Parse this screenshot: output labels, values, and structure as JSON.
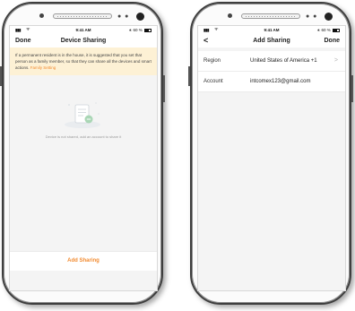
{
  "left_screen": {
    "status": {
      "signal": "▮▮▮",
      "wifi": "ᯤ",
      "time": "9:41 AM",
      "bluetooth": "∗",
      "battery_text": "60 %"
    },
    "nav": {
      "left": "Done",
      "title": "Device Sharing"
    },
    "notice": {
      "text": "If a permanent resident is in the house, it is suggested that you set that person as a family member, so that they can share all the devices and smart actions.",
      "link": "Family Setting"
    },
    "empty_state": {
      "text": "Device is not shared, add an account to share it"
    },
    "add_button": "Add Sharing"
  },
  "right_screen": {
    "status": {
      "signal": "▮▮▮",
      "wifi": "ᯤ",
      "time": "9:41 AM",
      "bluetooth": "∗",
      "battery_text": "60 %"
    },
    "nav": {
      "back": "<",
      "title": "Add Sharing",
      "right": "Done"
    },
    "rows": [
      {
        "label": "Region",
        "value": "United States of America +1",
        "chevron": ">"
      },
      {
        "label": "Account",
        "value": "intcomex123@gmail.com"
      }
    ]
  },
  "colors": {
    "accent": "#f28b31",
    "notice_bg": "#fdf1d5",
    "screen_bg": "#f4f4f4"
  },
  "icons": [
    "signal-icon",
    "wifi-icon",
    "bluetooth-icon",
    "battery-icon",
    "document-illustration-icon",
    "chevron-right-icon",
    "back-arrow-icon"
  ]
}
